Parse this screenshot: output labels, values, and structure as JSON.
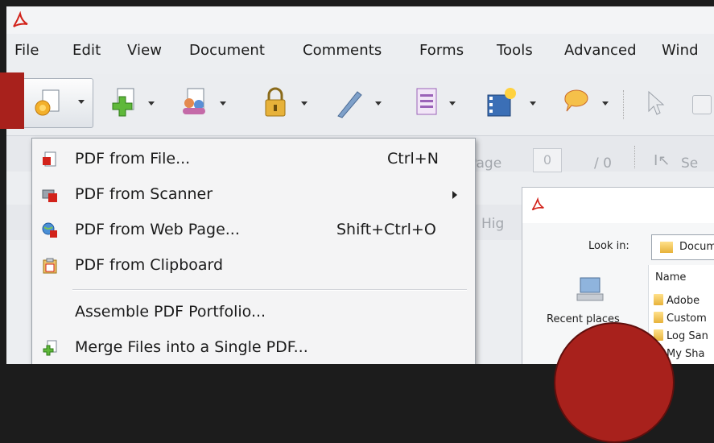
{
  "app": {
    "title": ""
  },
  "menubar": {
    "items": [
      "File",
      "Edit",
      "View",
      "Document",
      "Comments",
      "Forms",
      "Tools",
      "Advanced",
      "Wind"
    ]
  },
  "toolbar2": {
    "page_label": "Page",
    "page_value": "0",
    "page_total": "/ 0",
    "select_label": "Se"
  },
  "toolbar3": {
    "label": "Hig"
  },
  "create_menu": {
    "items": [
      {
        "label": "PDF from File...",
        "shortcut": "Ctrl+N",
        "icon": "pdf-from-file-icon",
        "submenu": false
      },
      {
        "label": "PDF from Scanner",
        "shortcut": "",
        "icon": "pdf-from-scanner-icon",
        "submenu": true
      },
      {
        "label": "PDF from Web Page...",
        "shortcut": "Shift+Ctrl+O",
        "icon": "pdf-from-web-icon",
        "submenu": false
      },
      {
        "label": "PDF from Clipboard",
        "shortcut": "",
        "icon": "pdf-from-clipboard-icon",
        "submenu": false
      },
      {
        "label": "Assemble PDF Portfolio...",
        "shortcut": "",
        "icon": "",
        "submenu": false
      },
      {
        "label": "Merge Files into a Single PDF...",
        "shortcut": "",
        "icon": "merge-files-icon",
        "submenu": false
      }
    ]
  },
  "dialog": {
    "look_in_label": "Look in:",
    "look_in_value": "Docume",
    "places": {
      "recent": "Recent places"
    },
    "column_name": "Name",
    "files": [
      "Adobe",
      "Custom",
      "Log San",
      "My Sha"
    ]
  },
  "colors": {
    "annotation_red": "#a8211c",
    "menu_bg": "#f4f4f5",
    "toolbar_bg": "#ebedf0"
  }
}
